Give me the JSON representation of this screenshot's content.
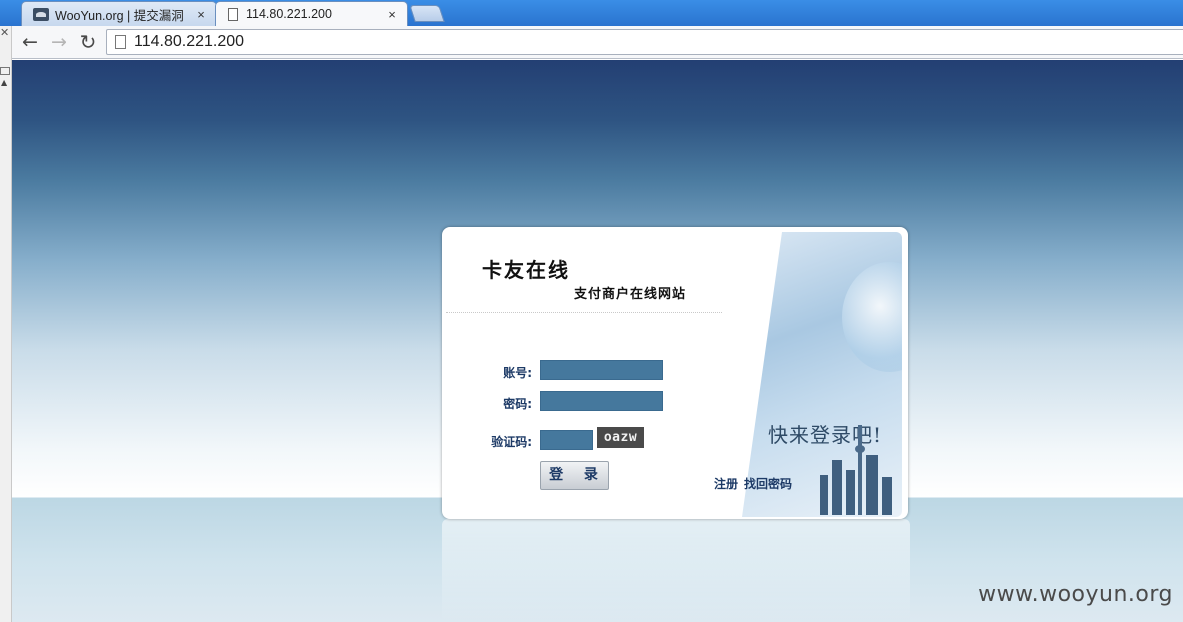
{
  "browser": {
    "tabs": [
      {
        "title": "WooYun.org | 提交漏洞",
        "active": false
      },
      {
        "title": "114.80.221.200",
        "active": true
      }
    ],
    "close_glyph": "×",
    "address": "114.80.221.200",
    "icons": {
      "back": "back-arrow-icon",
      "forward": "forward-arrow-icon",
      "reload": "reload-icon"
    }
  },
  "login": {
    "brand_title": "卡友在线",
    "brand_subtitle": "支付商户在线网站",
    "banner_text": "快来登录吧!",
    "account_label": "账号:",
    "password_label": "密码:",
    "captcha_label": "验证码:",
    "captcha_code": "oazw",
    "login_button": "登 录",
    "register_link": "注册",
    "recover_link": "找回密码"
  },
  "watermark": "www.wooyun.org",
  "colors": {
    "input_fill": "#45789d",
    "label_text": "#1d3a66",
    "page_top": "#233f73"
  }
}
